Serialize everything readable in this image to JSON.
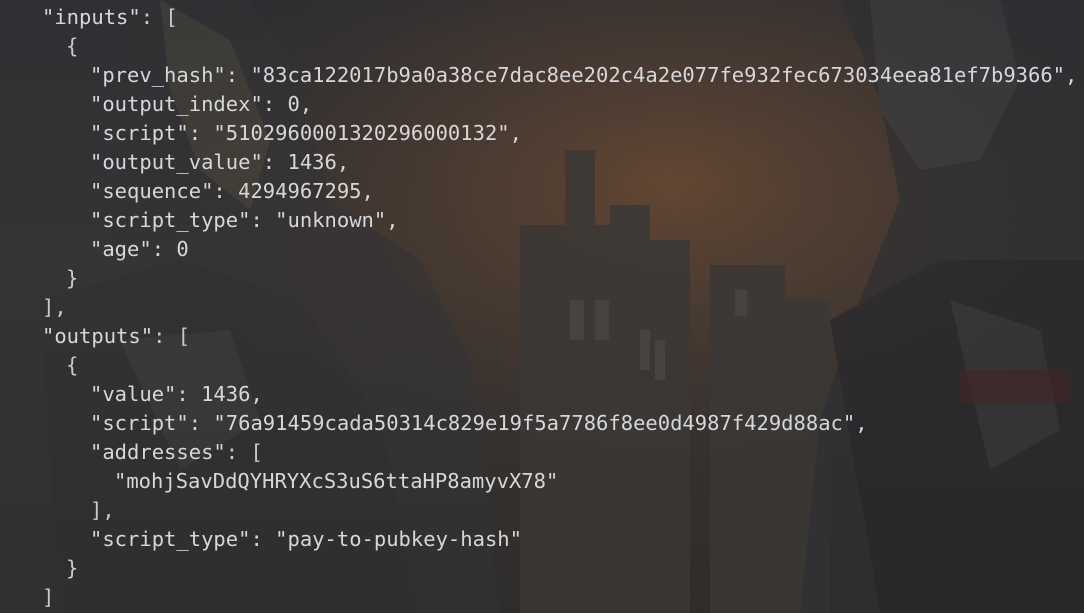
{
  "json_lines": {
    "l1": {
      "key": "\"inputs\"",
      "rest": ": ["
    },
    "l2": {
      "text": "{"
    },
    "l3": {
      "key": "\"prev_hash\"",
      "rest": ": \"83ca122017b9a0a38ce7dac8ee202c4a2e077fe932fec673034eea81ef7b9366\","
    },
    "l4": {
      "key": "\"output_index\"",
      "rest": ": 0,"
    },
    "l5": {
      "key": "\"script\"",
      "rest": ": \"5102960001320296000132\","
    },
    "l6": {
      "key": "\"output_value\"",
      "rest": ": 1436,"
    },
    "l7": {
      "key": "\"sequence\"",
      "rest": ": 4294967295,"
    },
    "l8": {
      "key": "\"script_type\"",
      "rest": ": \"unknown\","
    },
    "l9": {
      "key": "\"age\"",
      "rest": ": 0"
    },
    "l10": {
      "text": "}"
    },
    "l11": {
      "text": "],"
    },
    "l12": {
      "key": "\"outputs\"",
      "rest": ": ["
    },
    "l13": {
      "text": "{"
    },
    "l14": {
      "key": "\"value\"",
      "rest": ": 1436,"
    },
    "l15": {
      "key": "\"script\"",
      "rest": ": \"76a91459cada50314c829e19f5a7786f8ee0d4987f429d88ac\","
    },
    "l16": {
      "key": "\"addresses\"",
      "rest": ": ["
    },
    "l17": {
      "text": "\"mohjSavDdQYHRYXcS3uS6ttaHP8amyvX78\""
    },
    "l18": {
      "text": "],"
    },
    "l19": {
      "key": "\"script_type\"",
      "rest": ": \"pay-to-pubkey-hash\""
    },
    "l20": {
      "text": "}"
    },
    "l21": {
      "text": "]"
    }
  },
  "colors": {
    "text": "#d6d7da",
    "background": "#2c2d31",
    "sunset_glow": "#6b4a33"
  },
  "background_image": "anime-characters-wallpaper"
}
